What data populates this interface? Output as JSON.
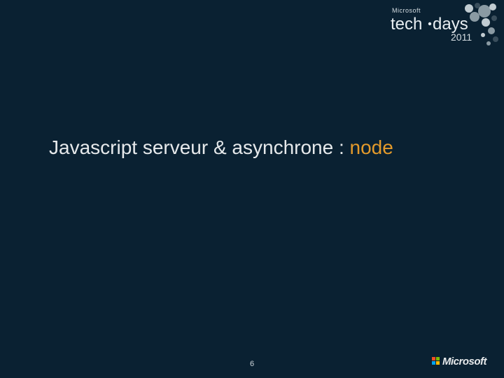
{
  "header": {
    "brand_small": "Microsoft",
    "brand_main_a": "tech",
    "brand_main_b": "days",
    "year": "2011"
  },
  "title": {
    "prefix": "Javascript serveur & asynchrone : ",
    "accent": "node"
  },
  "footer": {
    "page_number": "6",
    "company": "Microsoft"
  }
}
